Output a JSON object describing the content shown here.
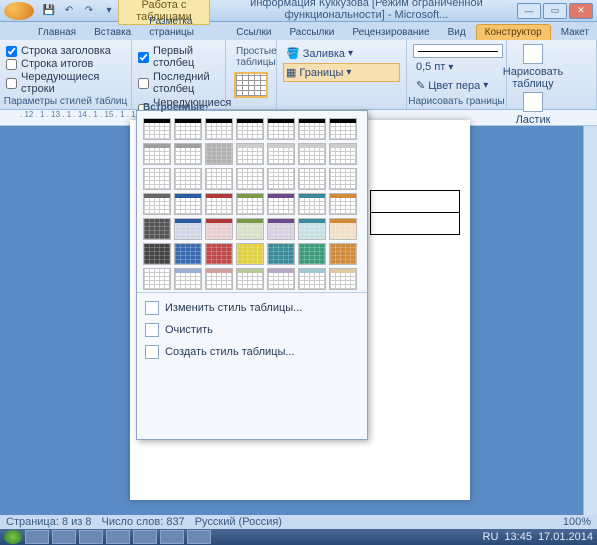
{
  "title": {
    "context_tab": "Работа с таблицами",
    "doc": "информация Куккузова [Режим ограниченной функциональности] - Microsoft..."
  },
  "qa_icons": [
    "save-icon",
    "undo-icon",
    "redo-icon",
    "print-icon"
  ],
  "ribbon_tabs": [
    "Главная",
    "Вставка",
    "Разметка страницы",
    "Ссылки",
    "Рассылки",
    "Рецензирование",
    "Вид",
    "Конструктор",
    "Макет"
  ],
  "active_tab": "Конструктор",
  "style_options": {
    "header_row": "Строка заголовка",
    "total_row": "Строка итогов",
    "banded_rows": "Чередующиеся строки",
    "first_col": "Первый столбец",
    "last_col": "Последний столбец",
    "banded_cols": "Чередующиеся столбцы",
    "group_title": "Параметры стилей таблиц"
  },
  "gallery": {
    "simple": "Простые таблицы",
    "builtin": "Встроенные",
    "modify": "Изменить стиль таблицы...",
    "clear": "Очистить",
    "new": "Создать стиль таблицы..."
  },
  "borders": {
    "shading": "Заливка",
    "borders_btn": "Границы",
    "pen_weight": "0,5 пт",
    "pen_color": "Цвет пера",
    "draw": "Нарисовать таблицу",
    "eraser": "Ластик",
    "group_title": "Нарисовать границы"
  },
  "ruler": ". 12 . 1 . 13 . 1 . 14 . 1 . 15 . 1 . 16 . 1 . 17 .",
  "status": {
    "page": "Страница: 8 из 8",
    "words": "Число слов: 837",
    "lang": "Русский (Россия)",
    "zoom": "100%"
  },
  "tray": {
    "time": "13:45",
    "date": "17.01.2014"
  }
}
